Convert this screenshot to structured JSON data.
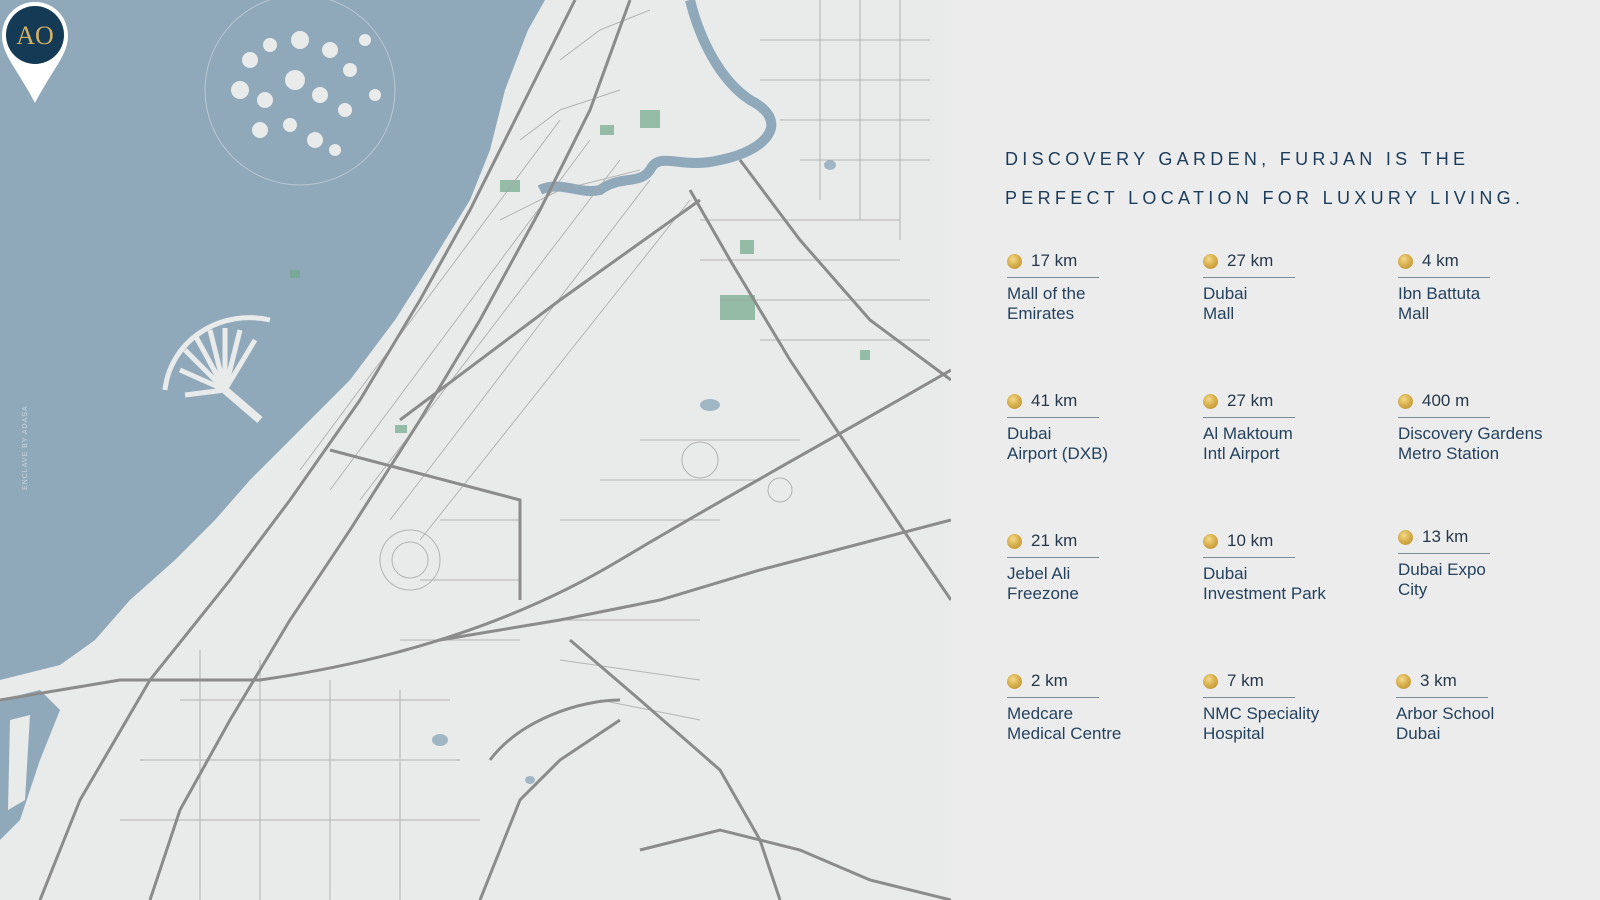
{
  "headline": {
    "line1": "DISCOVERY GARDEN, FURJAN IS THE",
    "line2": "PERFECT LOCATION FOR LUXURY LIVING."
  },
  "map": {
    "credit": "ENCLAVE BY ADASA",
    "pin_monogram": "AO",
    "colors": {
      "sea": "#8fa9bb",
      "land": "#e9eaea",
      "road": "#8b8b8b",
      "green": "#6fa88a",
      "pin": "#153a56"
    }
  },
  "destinations": [
    {
      "distance": "17 km",
      "name_line1": "Mall of the",
      "name_line2": "Emirates"
    },
    {
      "distance": "27 km",
      "name_line1": "Dubai",
      "name_line2": "Mall"
    },
    {
      "distance": "4 km",
      "name_line1": "Ibn Battuta",
      "name_line2": "Mall"
    },
    {
      "distance": "41 km",
      "name_line1": "Dubai",
      "name_line2": "Airport (DXB)"
    },
    {
      "distance": "27 km",
      "name_line1": "Al Maktoum",
      "name_line2": "Intl Airport"
    },
    {
      "distance": "400 m",
      "name_line1": "Discovery Gardens",
      "name_line2": "Metro Station"
    },
    {
      "distance": "21 km",
      "name_line1": "Jebel Ali",
      "name_line2": "Freezone"
    },
    {
      "distance": "10 km",
      "name_line1": "Dubai",
      "name_line2": "Investment Park"
    },
    {
      "distance": "13 km",
      "name_line1": "Dubai Expo",
      "name_line2": "City"
    },
    {
      "distance": "2 km",
      "name_line1": "Medcare",
      "name_line2": "Medical Centre"
    },
    {
      "distance": "7 km",
      "name_line1": "NMC Speciality",
      "name_line2": "Hospital"
    },
    {
      "distance": "3 km",
      "name_line1": "Arbor School",
      "name_line2": "Dubai"
    }
  ]
}
